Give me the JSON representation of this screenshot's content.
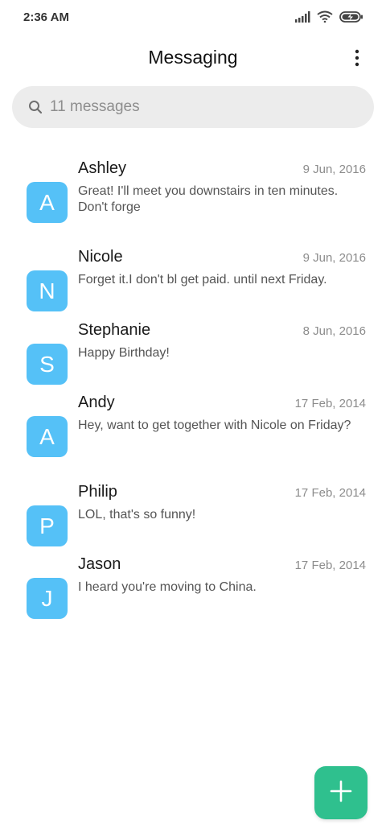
{
  "status_bar": {
    "time": "2:36 AM",
    "icons": [
      "signal-icon",
      "wifi-icon",
      "battery-charging-icon"
    ]
  },
  "header": {
    "title": "Messaging",
    "menu_icon": "more-vertical-icon"
  },
  "search": {
    "icon": "search-icon",
    "placeholder": "11 messages"
  },
  "conversations": [
    {
      "initial": "A",
      "name": "Ashley",
      "date": "9 Jun, 2016",
      "preview": "Great! I'll meet you downstairs in ten minutes. Don't forge"
    },
    {
      "initial": "N",
      "name": "Nicole",
      "date": "9 Jun, 2016",
      "preview": "Forget it.I don't bl get paid. until next Friday."
    },
    {
      "initial": "S",
      "name": "Stephanie",
      "date": "8 Jun, 2016",
      "preview": "Happy Birthday!"
    },
    {
      "initial": "A",
      "name": "Andy",
      "date": "17 Feb, 2014",
      "preview": "Hey, want to get together with Nicole on Friday?"
    },
    {
      "initial": "P",
      "name": "Philip",
      "date": "17 Feb, 2014",
      "preview": "LOL, that's so funny!"
    },
    {
      "initial": "J",
      "name": "Jason",
      "date": "17 Feb, 2014",
      "preview": "I heard you're moving to China."
    }
  ],
  "fab": {
    "icon": "plus-icon"
  },
  "colors": {
    "avatar": "#55c1f7",
    "fab": "#2fc08e",
    "search_bg": "#ececec"
  }
}
